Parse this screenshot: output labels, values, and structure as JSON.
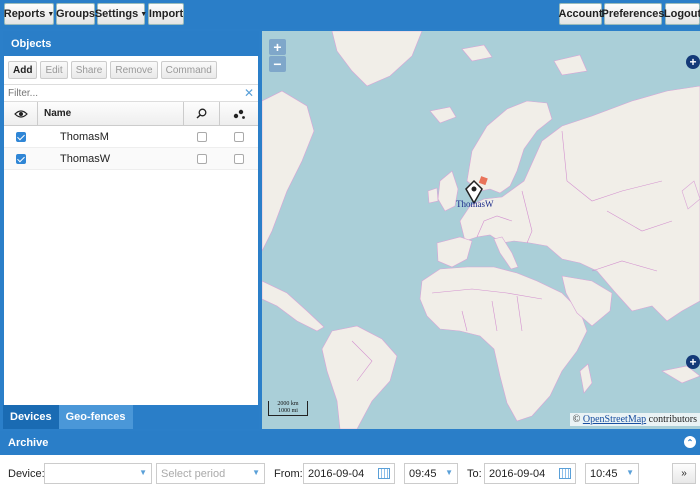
{
  "toolbar": {
    "reports": "Reports",
    "groups": "Groups",
    "settings": "Settings",
    "import": "Import",
    "account": "Account",
    "preferences": "Preferences",
    "logout": "Logout"
  },
  "objects": {
    "title": "Objects",
    "actions": {
      "add": "Add",
      "edit": "Edit",
      "share": "Share",
      "remove": "Remove",
      "command": "Command"
    },
    "filter_placeholder": "Filter...",
    "columns": {
      "name": "Name"
    },
    "rows": [
      {
        "name": "ThomasM",
        "visible": true
      },
      {
        "name": "ThomasW",
        "visible": true
      }
    ]
  },
  "tabs": {
    "devices": "Devices",
    "geofences": "Geo-fences"
  },
  "map": {
    "zoom_in": "+",
    "zoom_out": "−",
    "marker_label": "ThomasW",
    "scale_top": "2000 km",
    "scale_bottom": "1000 mi",
    "attribution_prefix": "©",
    "attribution_link": "OpenStreetMap",
    "attribution_suffix": "contributors"
  },
  "archive": {
    "title": "Archive",
    "device_label": "Device:",
    "device_value": "",
    "period_placeholder": "Select period",
    "from_label": "From:",
    "from_date": "2016-09-04",
    "from_time": "09:45",
    "to_label": "To:",
    "to_date": "2016-09-04",
    "to_time": "10:45",
    "more": "»"
  },
  "colors": {
    "accent": "#2a7ec8",
    "sea": "#aacfd8",
    "land": "#f1eee8",
    "border": "#cc7ac9"
  }
}
